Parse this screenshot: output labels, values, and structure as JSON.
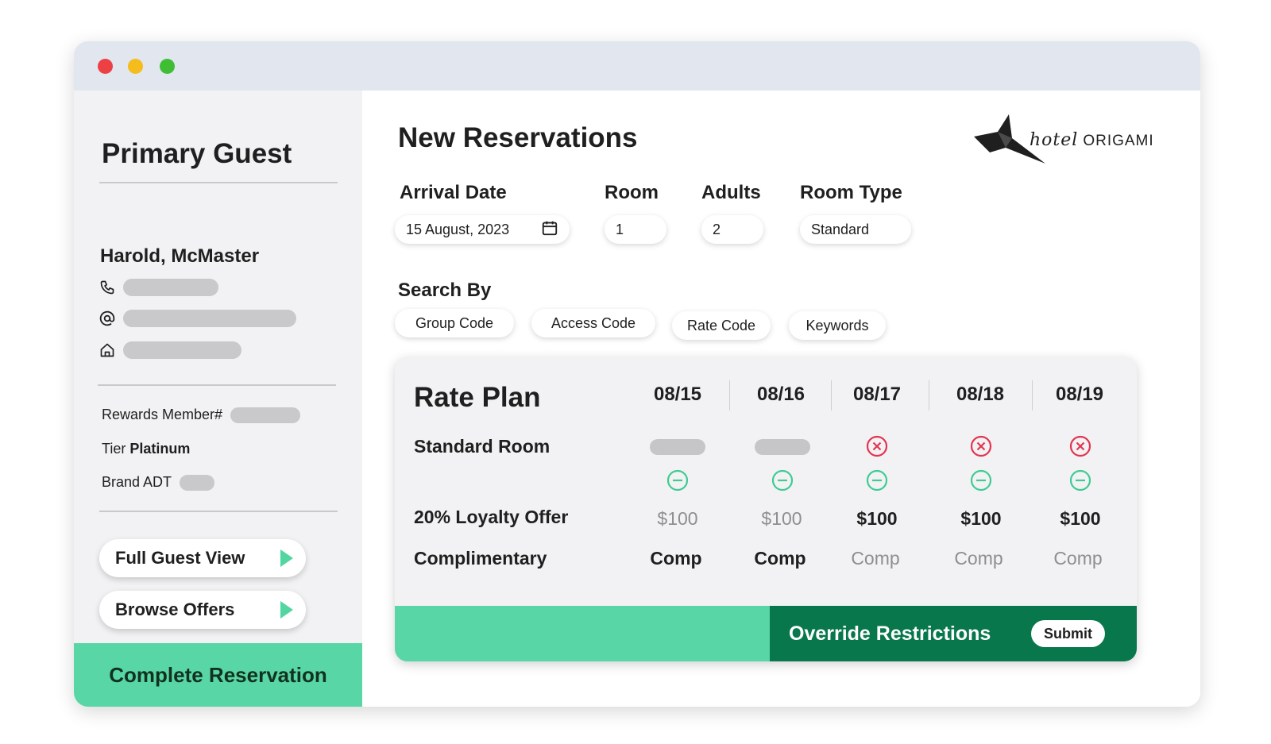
{
  "window": {
    "controls": [
      "close",
      "minimize",
      "maximize"
    ]
  },
  "sidebar": {
    "title": "Primary Guest",
    "guest_name": "Harold, McMaster",
    "contacts": [
      {
        "icon": "phone-icon"
      },
      {
        "icon": "at-icon"
      },
      {
        "icon": "home-icon"
      }
    ],
    "rewards_label": "Rewards Member#",
    "tier_label": "Tier",
    "tier_value": "Platinum",
    "brand_label": "Brand ADT",
    "buttons": {
      "full_guest_view": "Full Guest View",
      "browse_offers": "Browse Offers"
    },
    "complete_reservation": "Complete Reservation"
  },
  "main": {
    "title": "New Reservations",
    "logo": {
      "script": "hotel",
      "name": "ORIGAMI"
    },
    "fields": {
      "arrival_label": "Arrival Date",
      "arrival_value": "15 August, 2023",
      "room_label": "Room",
      "room_value": "1",
      "adults_label": "Adults",
      "adults_value": "2",
      "room_type_label": "Room Type",
      "room_type_value": "Standard"
    },
    "search_by": {
      "label": "Search By",
      "options": [
        "Group Code",
        "Access Code",
        "Rate Code",
        "Keywords"
      ]
    },
    "rate_plan": {
      "title": "Rate Plan",
      "dates": [
        "08/15",
        "08/16",
        "08/17",
        "08/18",
        "08/19"
      ],
      "rows": {
        "standard_room": "Standard Room",
        "loyalty": "20% Loyalty Offer",
        "complimentary": "Complimentary"
      },
      "availability": [
        "placeholder",
        "placeholder",
        "unavailable",
        "unavailable",
        "unavailable"
      ],
      "loyalty_prices": [
        "$100",
        "$100",
        "$100",
        "$100",
        "$100"
      ],
      "comp_values": [
        "Comp",
        "Comp",
        "Comp",
        "Comp",
        "Comp"
      ],
      "override_label": "Override Restrictions",
      "submit_label": "Submit"
    },
    "colors": {
      "accent_green": "#58d6a5",
      "dark_green": "#08774c",
      "red": "#e3344f"
    }
  }
}
